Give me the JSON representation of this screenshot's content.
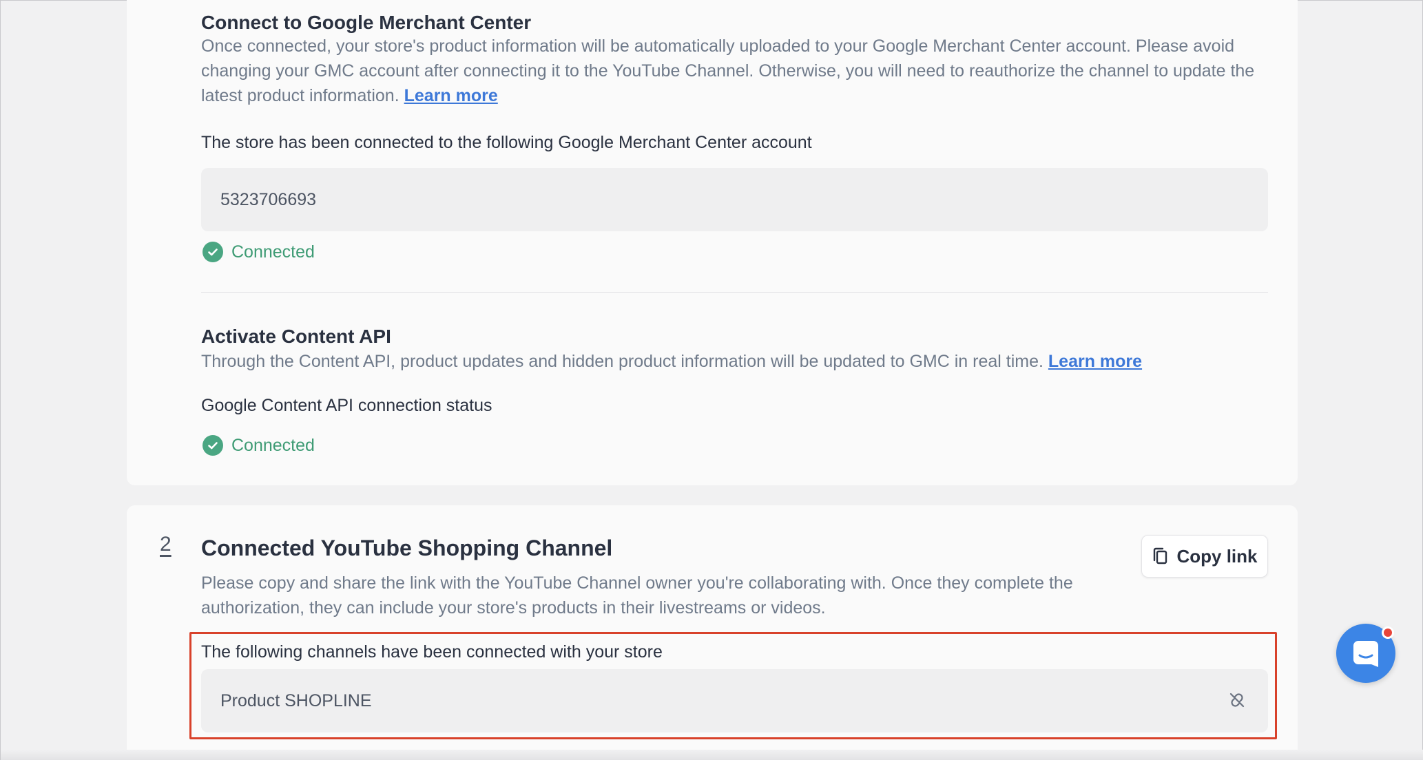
{
  "gmc": {
    "title": "Connect to Google Merchant Center",
    "description": "Once connected, your store's product information will be automatically uploaded to your Google Merchant Center account. Please avoid changing your GMC account after connecting it to the YouTube Channel. Otherwise, you will need to reauthorize the channel to update the latest product information.",
    "learn_more": "Learn more",
    "account_label": "The store has been connected to the following Google Merchant Center account",
    "account_id": "5323706693",
    "status": "Connected"
  },
  "content_api": {
    "title": "Activate Content API",
    "description": "Through the Content API, product updates and hidden product information will be updated to GMC in real time.",
    "learn_more": "Learn more",
    "status_label": "Google Content API connection status",
    "status": "Connected"
  },
  "youtube": {
    "step_number": "2",
    "title": "Connected YouTube Shopping Channel",
    "description": "Please copy and share the link with the YouTube Channel owner you're collaborating with. Once they complete the authorization, they can include your store's products in their livestreams or videos.",
    "copy_link_label": "Copy link",
    "channels_label": "The following channels have been connected with your store",
    "channel_name": "Product SHOPLINE"
  },
  "colors": {
    "accent_link": "#3d78d8",
    "success": "#3e9b74",
    "highlight_border": "#d8412a",
    "chat_button": "#3c85e6"
  },
  "icons": {
    "status": "check-circle-icon",
    "copy": "copy-icon",
    "unlink": "unlink-icon",
    "chat": "chat-icon"
  }
}
